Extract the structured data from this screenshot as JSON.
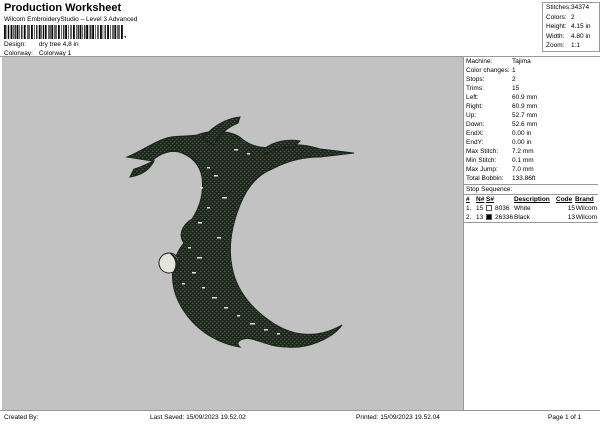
{
  "header": {
    "title": "Production Worksheet",
    "subtitle": "Wilcom EmbroideryStudio – Level 3 Advanced",
    "barcode_number": ","
  },
  "meta": {
    "design_label": "Design:",
    "design_value": "dry tree 4,8 in",
    "colorway_label": "Colorway:",
    "colorway_value": "Colorway 1"
  },
  "summary": [
    {
      "label": "Stitches:",
      "value": "34374"
    },
    {
      "label": "Colors:",
      "value": "2"
    },
    {
      "label": "Height:",
      "value": "4.15 in"
    },
    {
      "label": "Width:",
      "value": "4.80 in"
    },
    {
      "label": "Zoom:",
      "value": "1:1"
    }
  ],
  "properties": [
    {
      "label": "Machine:",
      "value": "Tajima"
    },
    {
      "label": "Color changes:",
      "value": "1"
    },
    {
      "label": "Stops:",
      "value": "2"
    },
    {
      "label": "Trims:",
      "value": "15"
    },
    {
      "label": "Left:",
      "value": "60.9 mm"
    },
    {
      "label": "Right:",
      "value": "60.9 mm"
    },
    {
      "label": "Up:",
      "value": "52.7 mm"
    },
    {
      "label": "Down:",
      "value": "52.6 mm"
    },
    {
      "label": "EndX:",
      "value": "0.00 in"
    },
    {
      "label": "EndY:",
      "value": "0.00 in"
    },
    {
      "label": "Max Stitch:",
      "value": "7.2 mm"
    },
    {
      "label": "Min Stitch:",
      "value": "0.1 mm"
    },
    {
      "label": "Max Jump:",
      "value": "7.0 mm"
    },
    {
      "label": "Total Bobbin:",
      "value": "133.86ft"
    }
  ],
  "stop_sequence": {
    "title": "Stop Sequence:",
    "headers": {
      "num": "#",
      "n": "N#",
      "sb": "S#",
      "description": "Description",
      "code": "Code",
      "brand": "Brand"
    },
    "rows": [
      {
        "num": "1.",
        "n": "15",
        "color": "#ffffff",
        "sb": "8036",
        "description": "White",
        "code": "15",
        "brand": "Wilcom"
      },
      {
        "num": "2.",
        "n": "13",
        "color": "#000000",
        "sb": "26336",
        "description": "Black",
        "code": "13",
        "brand": "Wilcom"
      }
    ]
  },
  "footer": {
    "created": "Created By:",
    "saved": "Last Saved: 15/09/2023 19.52.02",
    "printed": "Printed: 15/09/2023 19.52.04",
    "page": "Page 1 of 1"
  },
  "colors": {
    "canvas": "#c2c2c2",
    "tree": "#1f2a1e",
    "tree_highlight": "#e3e6d8"
  }
}
